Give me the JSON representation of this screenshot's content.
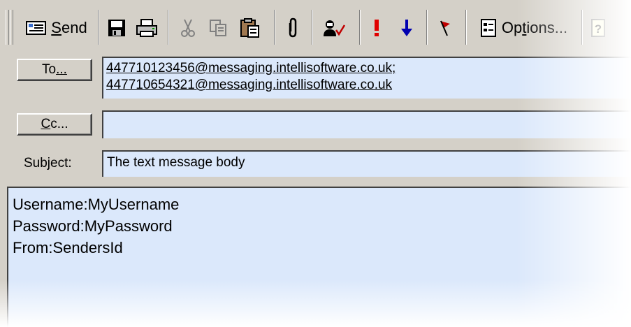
{
  "toolbar": {
    "send": {
      "label_pre": "",
      "label_ul": "S",
      "label_post": "end"
    },
    "options": {
      "label_pre": "Op",
      "label_ul": "t",
      "label_post": "ions..."
    },
    "icons": [
      "envelope-icon",
      "save-icon",
      "print-icon",
      "cut-icon",
      "copy-icon",
      "paste-icon",
      "paperclip-icon",
      "check-names-icon",
      "high-importance-icon",
      "low-importance-icon",
      "flag-icon",
      "options-icon",
      "help-icon"
    ]
  },
  "header": {
    "to_button": {
      "pre": "To",
      "ul": "...",
      "post": ""
    },
    "cc_button": {
      "pre": "",
      "ul": "C",
      "post": "c..."
    },
    "to_recipients": [
      "447710123456@messaging.intellisoftware.co.uk;",
      "447710654321@messaging.intellisoftware.co.uk"
    ],
    "cc_value": "",
    "subject_label": "Subject:",
    "subject_value": "The text message body"
  },
  "body": {
    "lines": [
      "Username:MyUsername",
      "Password:MyPassword",
      "From:SendersId"
    ]
  },
  "colors": {
    "field_bg": "#dbe8fb",
    "chrome": "#d4d0c8",
    "importance_high": "#e00000",
    "importance_low": "#0000b0"
  }
}
